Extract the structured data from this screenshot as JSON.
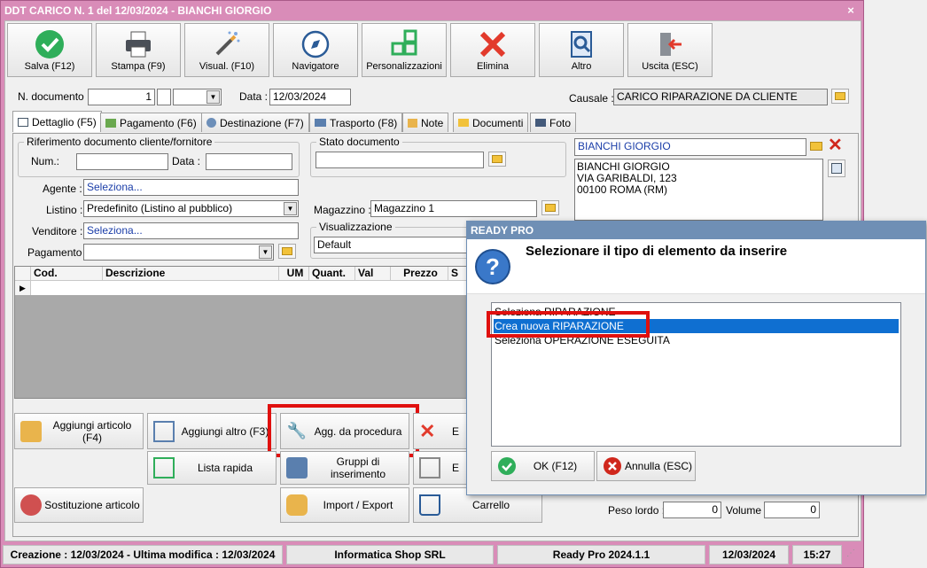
{
  "window": {
    "title": "DDT CARICO N. 1 del 12/03/2024 - BIANCHI GIORGIO",
    "close": "×"
  },
  "toolbar": [
    {
      "label": "Salva (F12)",
      "icon": "check-icon"
    },
    {
      "label": "Stampa (F9)",
      "icon": "printer-icon"
    },
    {
      "label": "Visual. (F10)",
      "icon": "magic-wand-icon"
    },
    {
      "label": "Navigatore",
      "icon": "compass-icon"
    },
    {
      "label": "Personalizzazioni",
      "icon": "grid-icon"
    },
    {
      "label": "Elimina",
      "icon": "delete-x-icon"
    },
    {
      "label": "Altro",
      "icon": "search-doc-icon"
    },
    {
      "label": "Uscita (ESC)",
      "icon": "exit-door-icon"
    }
  ],
  "header": {
    "ndoc_label": "N. documento :",
    "ndoc_value": "1",
    "data_label": "Data :",
    "data_value": "12/03/2024",
    "causale_label": "Causale :",
    "causale_value": "CARICO RIPARAZIONE DA CLIENTE"
  },
  "tabs": [
    {
      "label": "Dettaglio (F5)",
      "active": true
    },
    {
      "label": "Pagamento (F6)"
    },
    {
      "label": "Destinazione (F7)"
    },
    {
      "label": "Trasporto (F8)"
    },
    {
      "label": "Note"
    },
    {
      "label": "Documenti"
    },
    {
      "label": "Foto"
    }
  ],
  "form": {
    "riferimento_title": "Riferimento documento cliente/fornitore",
    "num_label": "Num.:",
    "data_label": "Data :",
    "stato_title": "Stato documento",
    "agente_label": "Agente :",
    "agente_value": "Seleziona...",
    "listino_label": "Listino :",
    "listino_value": "Predefinito (Listino al pubblico)",
    "venditore_label": "Venditore :",
    "venditore_value": "Seleziona...",
    "pagamento_label": "Pagamento :",
    "magazzino_label": "Magazzino :",
    "magazzino_value": "Magazzino 1",
    "visualizzazione_title": "Visualizzazione",
    "visualizzazione_value": "Default"
  },
  "customer": {
    "name": "BIANCHI GIORGIO",
    "address": [
      "BIANCHI GIORGIO",
      "VIA GARIBALDI, 123",
      "00100 ROMA (RM)"
    ]
  },
  "grid": {
    "columns": [
      "Cod.",
      "Descrizione",
      "UM",
      "Quant.",
      "Val",
      "Prezzo",
      "S"
    ]
  },
  "actions": {
    "aggiungi_articolo": "Aggiungi articolo (F4)",
    "aggiungi_altro": "Aggiungi altro (F3)",
    "agg_procedura": "Agg. da procedura",
    "e_label": "E",
    "lista_rapida": "Lista rapida",
    "gruppi": "Gruppi di inserimento",
    "e2_label": "E",
    "sostituzione": "Sostituzione articolo",
    "import_export": "Import / Export",
    "carrello": "Carrello"
  },
  "totals": {
    "peso_lordo_label": "Peso lordo :",
    "peso_lordo_value": "0",
    "volume_label": "Volume :",
    "volume_value": "0"
  },
  "statusbar": {
    "creazione": "Creazione : 12/03/2024 - Ultima modifica : 12/03/2024",
    "company": "Informatica Shop SRL",
    "version": "Ready Pro 2024.1.1",
    "date": "12/03/2024",
    "time": "15:27"
  },
  "dialog": {
    "title": "READY PRO",
    "message": "Selezionare il tipo di elemento da inserire",
    "options": [
      "Seleziona RIPARAZIONE",
      "Crea nuova RIPARAZIONE",
      "Seleziona OPERAZIONE ESEGUITA"
    ],
    "selected_index": 1,
    "ok": "OK (F12)",
    "cancel": "Annulla (ESC)"
  },
  "colors": {
    "title_bg": "#d98cb8",
    "dialog_title": "#6f8fb5",
    "highlight": "#e0100e",
    "selection": "#0f6fd1"
  }
}
